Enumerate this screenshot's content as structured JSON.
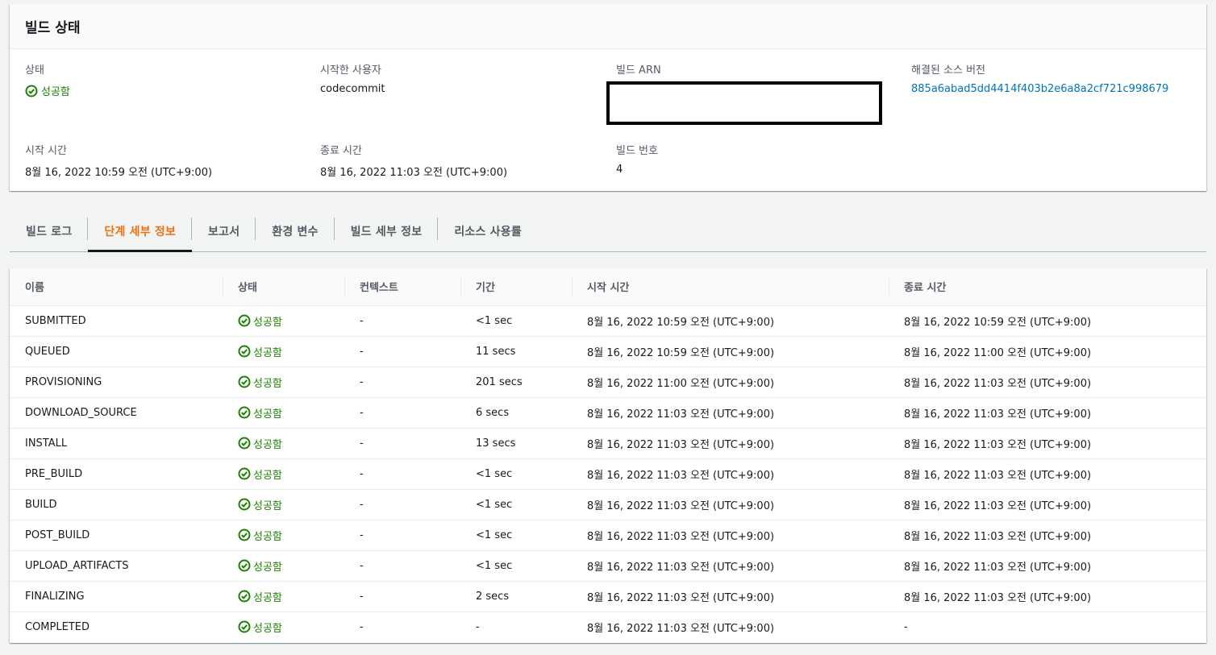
{
  "summary": {
    "title": "빌드 상태",
    "status_label": "상태",
    "status_value": "성공함",
    "initiator_label": "시작한 사용자",
    "initiator_value": "codecommit",
    "arn_label": "빌드 ARN",
    "source_label": "해결된 소스 버전",
    "source_value": "885a6abad5dd4414f403b2e6a8a2cf721c998679",
    "start_label": "시작 시간",
    "start_value": "8월 16, 2022 10:59 오전 (UTC+9:00)",
    "end_label": "종료 시간",
    "end_value": "8월 16, 2022 11:03 오전 (UTC+9:00)",
    "number_label": "빌드 번호",
    "number_value": "4"
  },
  "tabs": [
    {
      "label": "빌드 로그",
      "active": false
    },
    {
      "label": "단계 세부 정보",
      "active": true
    },
    {
      "label": "보고서",
      "active": false
    },
    {
      "label": "환경 변수",
      "active": false
    },
    {
      "label": "빌드 세부 정보",
      "active": false
    },
    {
      "label": "리소스 사용률",
      "active": false
    }
  ],
  "table": {
    "headers": [
      "이름",
      "상태",
      "컨텍스트",
      "기간",
      "시작 시간",
      "종료 시간"
    ],
    "rows": [
      {
        "name": "SUBMITTED",
        "status": "성공함",
        "context": "-",
        "duration": "<1 sec",
        "start": "8월 16, 2022 10:59 오전 (UTC+9:00)",
        "end": "8월 16, 2022 10:59 오전 (UTC+9:00)"
      },
      {
        "name": "QUEUED",
        "status": "성공함",
        "context": "-",
        "duration": "11 secs",
        "start": "8월 16, 2022 10:59 오전 (UTC+9:00)",
        "end": "8월 16, 2022 11:00 오전 (UTC+9:00)"
      },
      {
        "name": "PROVISIONING",
        "status": "성공함",
        "context": "-",
        "duration": "201 secs",
        "start": "8월 16, 2022 11:00 오전 (UTC+9:00)",
        "end": "8월 16, 2022 11:03 오전 (UTC+9:00)"
      },
      {
        "name": "DOWNLOAD_SOURCE",
        "status": "성공함",
        "context": "-",
        "duration": "6 secs",
        "start": "8월 16, 2022 11:03 오전 (UTC+9:00)",
        "end": "8월 16, 2022 11:03 오전 (UTC+9:00)"
      },
      {
        "name": "INSTALL",
        "status": "성공함",
        "context": "-",
        "duration": "13 secs",
        "start": "8월 16, 2022 11:03 오전 (UTC+9:00)",
        "end": "8월 16, 2022 11:03 오전 (UTC+9:00)"
      },
      {
        "name": "PRE_BUILD",
        "status": "성공함",
        "context": "-",
        "duration": "<1 sec",
        "start": "8월 16, 2022 11:03 오전 (UTC+9:00)",
        "end": "8월 16, 2022 11:03 오전 (UTC+9:00)"
      },
      {
        "name": "BUILD",
        "status": "성공함",
        "context": "-",
        "duration": "<1 sec",
        "start": "8월 16, 2022 11:03 오전 (UTC+9:00)",
        "end": "8월 16, 2022 11:03 오전 (UTC+9:00)"
      },
      {
        "name": "POST_BUILD",
        "status": "성공함",
        "context": "-",
        "duration": "<1 sec",
        "start": "8월 16, 2022 11:03 오전 (UTC+9:00)",
        "end": "8월 16, 2022 11:03 오전 (UTC+9:00)"
      },
      {
        "name": "UPLOAD_ARTIFACTS",
        "status": "성공함",
        "context": "-",
        "duration": "<1 sec",
        "start": "8월 16, 2022 11:03 오전 (UTC+9:00)",
        "end": "8월 16, 2022 11:03 오전 (UTC+9:00)"
      },
      {
        "name": "FINALIZING",
        "status": "성공함",
        "context": "-",
        "duration": "2 secs",
        "start": "8월 16, 2022 11:03 오전 (UTC+9:00)",
        "end": "8월 16, 2022 11:03 오전 (UTC+9:00)"
      },
      {
        "name": "COMPLETED",
        "status": "성공함",
        "context": "-",
        "duration": "-",
        "start": "8월 16, 2022 11:03 오전 (UTC+9:00)",
        "end": "-"
      }
    ]
  },
  "colors": {
    "success": "#1d8102",
    "link": "#0073bb",
    "active_tab": "#ec7211"
  },
  "icons": {
    "status": "status-success-icon"
  }
}
